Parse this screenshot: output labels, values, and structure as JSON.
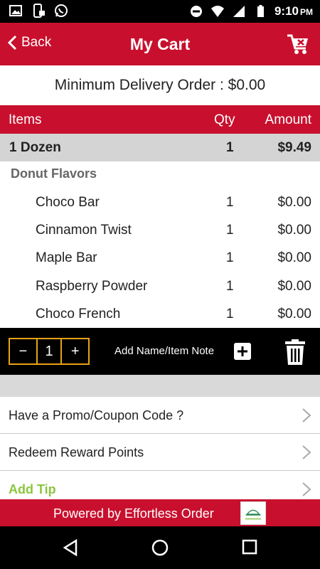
{
  "status_bar": {
    "time": "9:10",
    "ampm": "PM",
    "left_icons": [
      "image-icon",
      "phone-lock-icon",
      "whatsapp-icon"
    ],
    "right_icons": [
      "do-not-disturb-icon",
      "wifi-icon",
      "signal-icon",
      "battery-icon"
    ]
  },
  "header": {
    "back_label": "Back",
    "title": "My Cart"
  },
  "min_delivery": "Minimum Delivery Order : $0.00",
  "table": {
    "headers": {
      "items": "Items",
      "qty": "Qty",
      "amount": "Amount"
    },
    "main_item": {
      "name": "1 Dozen",
      "qty": "1",
      "amount": "$9.49"
    },
    "flavor_heading": "Donut Flavors",
    "flavors": [
      {
        "name": "Choco Bar",
        "qty": "1",
        "amount": "$0.00"
      },
      {
        "name": "Cinnamon Twist",
        "qty": "1",
        "amount": "$0.00"
      },
      {
        "name": "Maple Bar",
        "qty": "1",
        "amount": "$0.00"
      },
      {
        "name": "Raspberry Powder",
        "qty": "1",
        "amount": "$0.00"
      },
      {
        "name": "Choco French",
        "qty": "1",
        "amount": "$0.00"
      }
    ]
  },
  "controls": {
    "minus": "−",
    "quantity": "1",
    "plus": "+",
    "note_label": "Add Name/Item Note"
  },
  "options": [
    {
      "label": "Have a Promo/Coupon Code ?"
    },
    {
      "label": "Redeem Reward Points"
    },
    {
      "label": "Add Tip"
    }
  ],
  "footer": {
    "text": "Powered by Effortless Order",
    "logo_text": "Effortless Order"
  },
  "colors": {
    "brand_red": "#c8102e",
    "accent_orange": "#e8a317",
    "tip_green": "#8cc63f"
  }
}
